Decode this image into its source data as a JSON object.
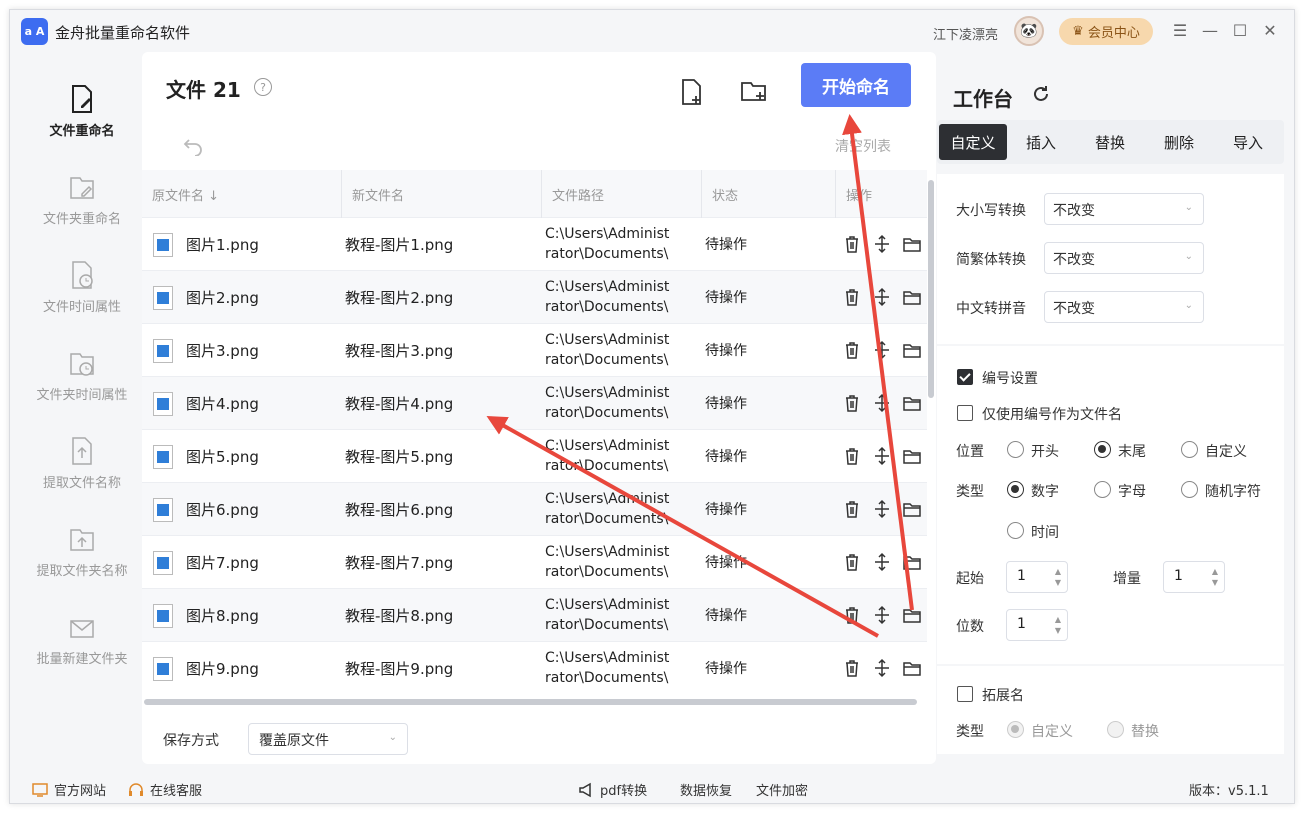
{
  "app": {
    "title": "金舟批量重命名软件",
    "logo_text": "a A",
    "user_name": "江下凌漂亮",
    "vip_label": "会员中心"
  },
  "nav": [
    {
      "label": "文件重命名",
      "icon": "file-edit-icon",
      "active": true
    },
    {
      "label": "文件夹重命名",
      "icon": "folder-edit-icon",
      "active": false
    },
    {
      "label": "文件时间属性",
      "icon": "file-clock-icon",
      "active": false
    },
    {
      "label": "文件夹时间属性",
      "icon": "folder-clock-icon",
      "active": false
    },
    {
      "label": "提取文件名称",
      "icon": "file-upload-icon",
      "active": false
    },
    {
      "label": "提取文件夹名称",
      "icon": "folder-upload-icon",
      "active": false
    },
    {
      "label": "批量新建文件夹",
      "icon": "mail-icon",
      "active": false
    }
  ],
  "main": {
    "title": "文件 21",
    "start_button": "开始命名",
    "clear_list": "清空列表",
    "columns": [
      "原文件名",
      "新文件名",
      "文件路径",
      "状态",
      "操作"
    ],
    "rows": [
      {
        "orig": "图片1.png",
        "new": "教程-图片1.png",
        "path1": "C:\\Users\\Administ",
        "path2": "rator\\Documents\\",
        "status": "待操作"
      },
      {
        "orig": "图片2.png",
        "new": "教程-图片2.png",
        "path1": "C:\\Users\\Administ",
        "path2": "rator\\Documents\\",
        "status": "待操作"
      },
      {
        "orig": "图片3.png",
        "new": "教程-图片3.png",
        "path1": "C:\\Users\\Administ",
        "path2": "rator\\Documents\\",
        "status": "待操作"
      },
      {
        "orig": "图片4.png",
        "new": "教程-图片4.png",
        "path1": "C:\\Users\\Administ",
        "path2": "rator\\Documents\\",
        "status": "待操作"
      },
      {
        "orig": "图片5.png",
        "new": "教程-图片5.png",
        "path1": "C:\\Users\\Administ",
        "path2": "rator\\Documents\\",
        "status": "待操作"
      },
      {
        "orig": "图片6.png",
        "new": "教程-图片6.png",
        "path1": "C:\\Users\\Administ",
        "path2": "rator\\Documents\\",
        "status": "待操作"
      },
      {
        "orig": "图片7.png",
        "new": "教程-图片7.png",
        "path1": "C:\\Users\\Administ",
        "path2": "rator\\Documents\\",
        "status": "待操作"
      },
      {
        "orig": "图片8.png",
        "new": "教程-图片8.png",
        "path1": "C:\\Users\\Administ",
        "path2": "rator\\Documents\\",
        "status": "待操作"
      },
      {
        "orig": "图片9.png",
        "new": "教程-图片9.png",
        "path1": "C:\\Users\\Administ",
        "path2": "rator\\Documents\\",
        "status": "待操作"
      }
    ],
    "save_label": "保存方式",
    "save_value": "覆盖原文件"
  },
  "workspace": {
    "title": "工作台",
    "tabs": [
      "自定义",
      "插入",
      "替换",
      "删除",
      "导入"
    ],
    "case_label": "大小写转换",
    "case_value": "不改变",
    "trad_label": "简繁体转换",
    "trad_value": "不改变",
    "pinyin_label": "中文转拼音",
    "pinyin_value": "不改变",
    "numbering_label": "编号设置",
    "numbering_checked": true,
    "only_number_label": "仅使用编号作为文件名",
    "only_number_checked": false,
    "position_label": "位置",
    "position_options": [
      "开头",
      "末尾",
      "自定义"
    ],
    "position_selected": "末尾",
    "type_label": "类型",
    "type_options": [
      "数字",
      "字母",
      "随机字符",
      "时间"
    ],
    "type_selected": "数字",
    "start_label": "起始",
    "start_value": "1",
    "increment_label": "增量",
    "increment_value": "1",
    "digits_label": "位数",
    "digits_value": "1",
    "ext_label": "拓展名",
    "ext_checked": false,
    "ext_type_label": "类型",
    "ext_type_options": [
      "自定义",
      "替换"
    ],
    "ext_type_selected": "自定义"
  },
  "statusbar": {
    "website": "官方网站",
    "support": "在线客服",
    "pdf": "pdf转换",
    "recovery": "数据恢复",
    "encrypt": "文件加密",
    "version": "版本：v5.1.1"
  },
  "colors": {
    "accent": "#5b7cf6",
    "annotation_arrow": "#e8473c",
    "dark_tab": "#2d2f33"
  }
}
